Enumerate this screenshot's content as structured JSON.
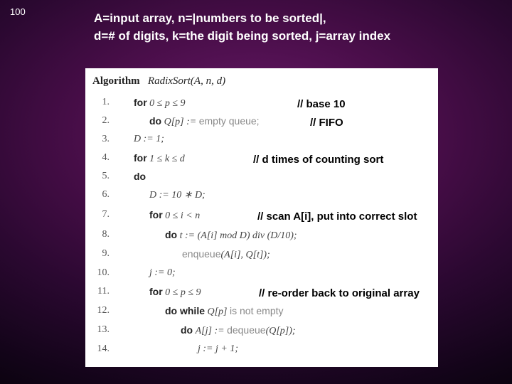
{
  "slide_number": "100",
  "header_line1": "A=input array, n=|numbers to be sorted|,",
  "header_line2": "d=# of digits, k=the digit being sorted, j=array index",
  "algo_title_prefix": "Algorithm",
  "algo_title_name": "RadixSort",
  "algo_title_args": "(A, n, d)",
  "lines": {
    "n1": "1.",
    "n2": "2.",
    "n3": "3.",
    "n4": "4.",
    "n5": "5.",
    "n6": "6.",
    "n7": "7.",
    "n8": "8.",
    "n9": "9.",
    "n10": "10.",
    "n11": "11.",
    "n12": "12.",
    "n13": "13.",
    "n14": "14."
  },
  "code": {
    "l1_kw": "for",
    "l1_m": "0 ≤ p ≤ 9",
    "l2_kw": "do",
    "l2_m": "Q[p] :=",
    "l2_txt": "empty queue;",
    "l3_m": "D := 1;",
    "l4_kw": "for",
    "l4_m": "1 ≤ k ≤ d",
    "l5_kw": "do",
    "l6_m": "D := 10 ∗ D;",
    "l7_kw": "for",
    "l7_m": "0 ≤ i < n",
    "l8_kw": "do",
    "l8_m": "t := (A[i] mod D) div (D/10);",
    "l9_txt": "enqueue",
    "l9_m": "(A[i], Q[t]);",
    "l10_m": "j := 0;",
    "l11_kw": "for",
    "l11_m": "0 ≤ p ≤ 9",
    "l12_kw": "do while",
    "l12_m": "Q[p]",
    "l12_txt": "is not empty",
    "l13_kw": "do",
    "l13_m": "A[j] :=",
    "l13_txt": "dequeue",
    "l13_m2": "(Q[p]);",
    "l14_m": "j := j + 1;"
  },
  "annot": {
    "a1": "// base 10",
    "a2": "// FIFO",
    "a3": "// d times of counting sort",
    "a4": "// scan A[i], put into correct slot",
    "a5": "// re-order back to original array"
  }
}
